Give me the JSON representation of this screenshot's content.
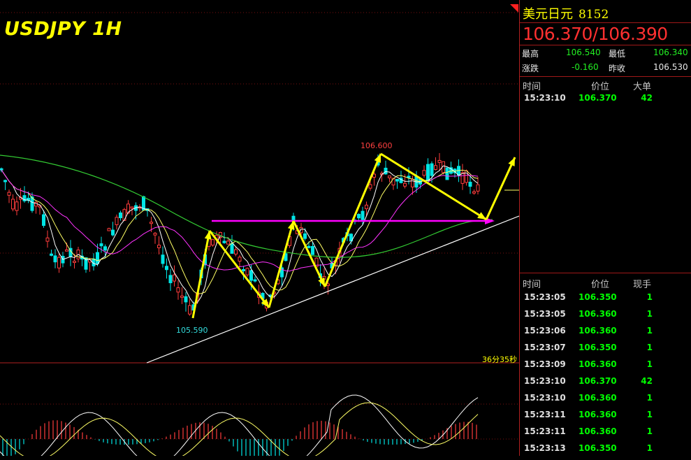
{
  "chart": {
    "symbol_title": "USDJPY 1H",
    "high_marker": "106.600",
    "low_marker": "105.590",
    "countdown": "36分35秒"
  },
  "colors": {
    "up": "#ff3c3c",
    "down": "#00e5e5",
    "arrow": "#ffff00",
    "support_line": "#ff00ff",
    "ma_white": "#ffffff",
    "ma_yellow": "#ffff66",
    "ma_magenta": "#ff33ff",
    "ma_green": "#33cc33"
  },
  "panel": {
    "name": "美元日元",
    "code": "8152",
    "quote": "106.370/106.390",
    "stats": {
      "high_label": "最高",
      "high_value": "106.540",
      "low_label": "最低",
      "low_value": "106.340",
      "change_label": "涨跌",
      "change_value": "-0.160",
      "prev_close_label": "昨收",
      "prev_close_value": "106.530"
    },
    "big_orders": {
      "headers": {
        "time": "时间",
        "price": "价位",
        "volume": "大单"
      },
      "rows": [
        {
          "time": "15:23:10",
          "price": "106.370",
          "volume": "42"
        }
      ]
    },
    "ticks": {
      "headers": {
        "time": "时间",
        "price": "价位",
        "volume": "现手"
      },
      "rows": [
        {
          "time": "15:23:05",
          "price": "106.350",
          "volume": "1"
        },
        {
          "time": "15:23:05",
          "price": "106.360",
          "volume": "1"
        },
        {
          "time": "15:23:06",
          "price": "106.360",
          "volume": "1"
        },
        {
          "time": "15:23:07",
          "price": "106.350",
          "volume": "1"
        },
        {
          "time": "15:23:09",
          "price": "106.360",
          "volume": "1"
        },
        {
          "time": "15:23:10",
          "price": "106.370",
          "volume": "42"
        },
        {
          "time": "15:23:10",
          "price": "106.360",
          "volume": "1"
        },
        {
          "time": "15:23:11",
          "price": "106.360",
          "volume": "1"
        },
        {
          "time": "15:23:11",
          "price": "106.360",
          "volume": "1"
        },
        {
          "time": "15:23:13",
          "price": "106.350",
          "volume": "1"
        }
      ]
    }
  }
}
